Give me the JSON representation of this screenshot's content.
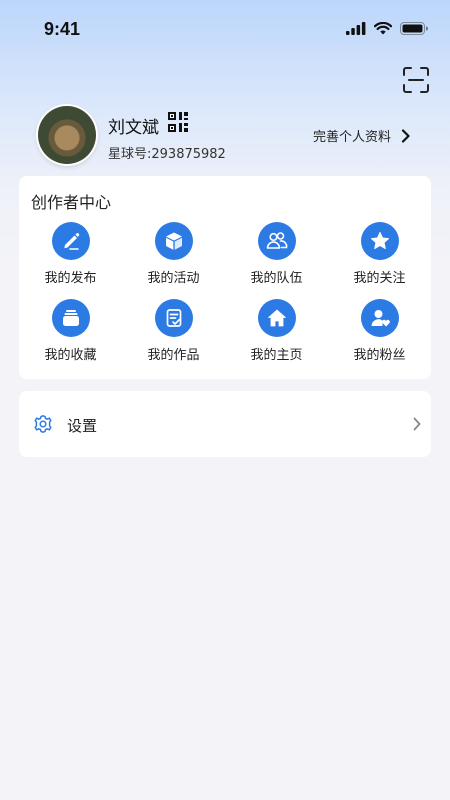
{
  "status_bar": {
    "time": "9:41"
  },
  "profile": {
    "name": "刘文斌",
    "id_text": "星球号:293875982",
    "edit_label": "完善个人资料"
  },
  "creator_center": {
    "title": "创作者中心",
    "items": [
      {
        "label": "我的发布",
        "icon": "pencil-icon"
      },
      {
        "label": "我的活动",
        "icon": "box-icon"
      },
      {
        "label": "我的队伍",
        "icon": "team-icon"
      },
      {
        "label": "我的关注",
        "icon": "star-icon"
      },
      {
        "label": "我的收藏",
        "icon": "collection-icon"
      },
      {
        "label": "我的作品",
        "icon": "clipboard-check-icon"
      },
      {
        "label": "我的主页",
        "icon": "home-icon"
      },
      {
        "label": "我的粉丝",
        "icon": "fans-icon"
      }
    ]
  },
  "settings": {
    "label": "设置"
  },
  "colors": {
    "accent": "#2c7be5",
    "card": "#ffffff",
    "background": "#f4f4f8"
  }
}
